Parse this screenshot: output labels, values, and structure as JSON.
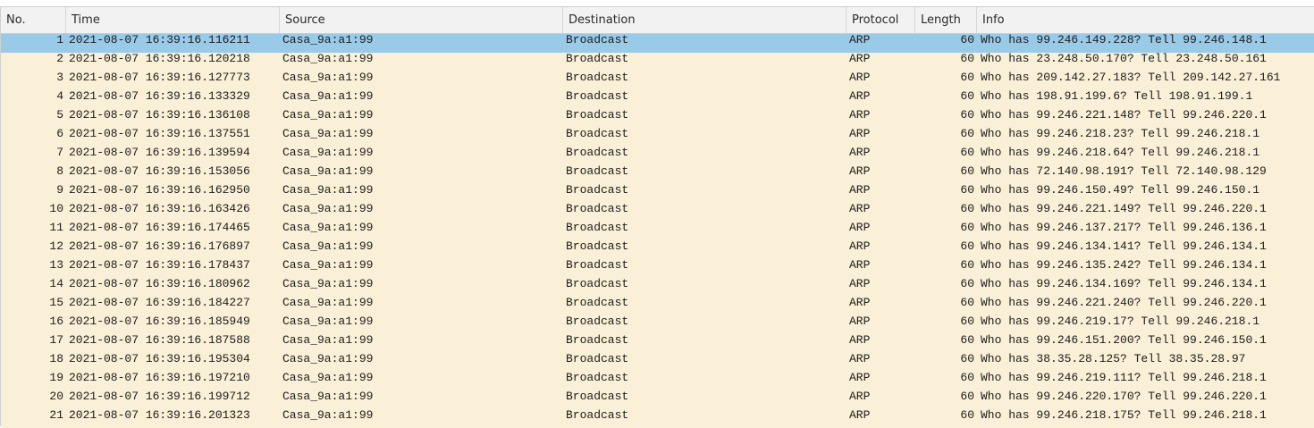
{
  "columns": [
    "No.",
    "Time",
    "Source",
    "Destination",
    "Protocol",
    "Length",
    "Info"
  ],
  "selected_row": 1,
  "colors": {
    "row_bg": "#faf0d7",
    "selected_bg": "#99cbe9",
    "header_bg": "#f2f2f2"
  },
  "packets": [
    {
      "no": "1",
      "time": "2021-08-07 16:39:16.116211",
      "source": "Casa_9a:a1:99",
      "destination": "Broadcast",
      "protocol": "ARP",
      "length": "60",
      "info": "Who has 99.246.149.228? Tell 99.246.148.1"
    },
    {
      "no": "2",
      "time": "2021-08-07 16:39:16.120218",
      "source": "Casa_9a:a1:99",
      "destination": "Broadcast",
      "protocol": "ARP",
      "length": "60",
      "info": "Who has 23.248.50.170? Tell 23.248.50.161"
    },
    {
      "no": "3",
      "time": "2021-08-07 16:39:16.127773",
      "source": "Casa_9a:a1:99",
      "destination": "Broadcast",
      "protocol": "ARP",
      "length": "60",
      "info": "Who has 209.142.27.183? Tell 209.142.27.161"
    },
    {
      "no": "4",
      "time": "2021-08-07 16:39:16.133329",
      "source": "Casa_9a:a1:99",
      "destination": "Broadcast",
      "protocol": "ARP",
      "length": "60",
      "info": "Who has 198.91.199.6? Tell 198.91.199.1"
    },
    {
      "no": "5",
      "time": "2021-08-07 16:39:16.136108",
      "source": "Casa_9a:a1:99",
      "destination": "Broadcast",
      "protocol": "ARP",
      "length": "60",
      "info": "Who has 99.246.221.148? Tell 99.246.220.1"
    },
    {
      "no": "6",
      "time": "2021-08-07 16:39:16.137551",
      "source": "Casa_9a:a1:99",
      "destination": "Broadcast",
      "protocol": "ARP",
      "length": "60",
      "info": "Who has 99.246.218.23? Tell 99.246.218.1"
    },
    {
      "no": "7",
      "time": "2021-08-07 16:39:16.139594",
      "source": "Casa_9a:a1:99",
      "destination": "Broadcast",
      "protocol": "ARP",
      "length": "60",
      "info": "Who has 99.246.218.64? Tell 99.246.218.1"
    },
    {
      "no": "8",
      "time": "2021-08-07 16:39:16.153056",
      "source": "Casa_9a:a1:99",
      "destination": "Broadcast",
      "protocol": "ARP",
      "length": "60",
      "info": "Who has 72.140.98.191? Tell 72.140.98.129"
    },
    {
      "no": "9",
      "time": "2021-08-07 16:39:16.162950",
      "source": "Casa_9a:a1:99",
      "destination": "Broadcast",
      "protocol": "ARP",
      "length": "60",
      "info": "Who has 99.246.150.49? Tell 99.246.150.1"
    },
    {
      "no": "10",
      "time": "2021-08-07 16:39:16.163426",
      "source": "Casa_9a:a1:99",
      "destination": "Broadcast",
      "protocol": "ARP",
      "length": "60",
      "info": "Who has 99.246.221.149? Tell 99.246.220.1"
    },
    {
      "no": "11",
      "time": "2021-08-07 16:39:16.174465",
      "source": "Casa_9a:a1:99",
      "destination": "Broadcast",
      "protocol": "ARP",
      "length": "60",
      "info": "Who has 99.246.137.217? Tell 99.246.136.1"
    },
    {
      "no": "12",
      "time": "2021-08-07 16:39:16.176897",
      "source": "Casa_9a:a1:99",
      "destination": "Broadcast",
      "protocol": "ARP",
      "length": "60",
      "info": "Who has 99.246.134.141? Tell 99.246.134.1"
    },
    {
      "no": "13",
      "time": "2021-08-07 16:39:16.178437",
      "source": "Casa_9a:a1:99",
      "destination": "Broadcast",
      "protocol": "ARP",
      "length": "60",
      "info": "Who has 99.246.135.242? Tell 99.246.134.1"
    },
    {
      "no": "14",
      "time": "2021-08-07 16:39:16.180962",
      "source": "Casa_9a:a1:99",
      "destination": "Broadcast",
      "protocol": "ARP",
      "length": "60",
      "info": "Who has 99.246.134.169? Tell 99.246.134.1"
    },
    {
      "no": "15",
      "time": "2021-08-07 16:39:16.184227",
      "source": "Casa_9a:a1:99",
      "destination": "Broadcast",
      "protocol": "ARP",
      "length": "60",
      "info": "Who has 99.246.221.240? Tell 99.246.220.1"
    },
    {
      "no": "16",
      "time": "2021-08-07 16:39:16.185949",
      "source": "Casa_9a:a1:99",
      "destination": "Broadcast",
      "protocol": "ARP",
      "length": "60",
      "info": "Who has 99.246.219.17? Tell 99.246.218.1"
    },
    {
      "no": "17",
      "time": "2021-08-07 16:39:16.187588",
      "source": "Casa_9a:a1:99",
      "destination": "Broadcast",
      "protocol": "ARP",
      "length": "60",
      "info": "Who has 99.246.151.200? Tell 99.246.150.1"
    },
    {
      "no": "18",
      "time": "2021-08-07 16:39:16.195304",
      "source": "Casa_9a:a1:99",
      "destination": "Broadcast",
      "protocol": "ARP",
      "length": "60",
      "info": "Who has 38.35.28.125? Tell 38.35.28.97"
    },
    {
      "no": "19",
      "time": "2021-08-07 16:39:16.197210",
      "source": "Casa_9a:a1:99",
      "destination": "Broadcast",
      "protocol": "ARP",
      "length": "60",
      "info": "Who has 99.246.219.111? Tell 99.246.218.1"
    },
    {
      "no": "20",
      "time": "2021-08-07 16:39:16.199712",
      "source": "Casa_9a:a1:99",
      "destination": "Broadcast",
      "protocol": "ARP",
      "length": "60",
      "info": "Who has 99.246.220.170? Tell 99.246.220.1"
    },
    {
      "no": "21",
      "time": "2021-08-07 16:39:16.201323",
      "source": "Casa_9a:a1:99",
      "destination": "Broadcast",
      "protocol": "ARP",
      "length": "60",
      "info": "Who has 99.246.218.175? Tell 99.246.218.1"
    }
  ]
}
